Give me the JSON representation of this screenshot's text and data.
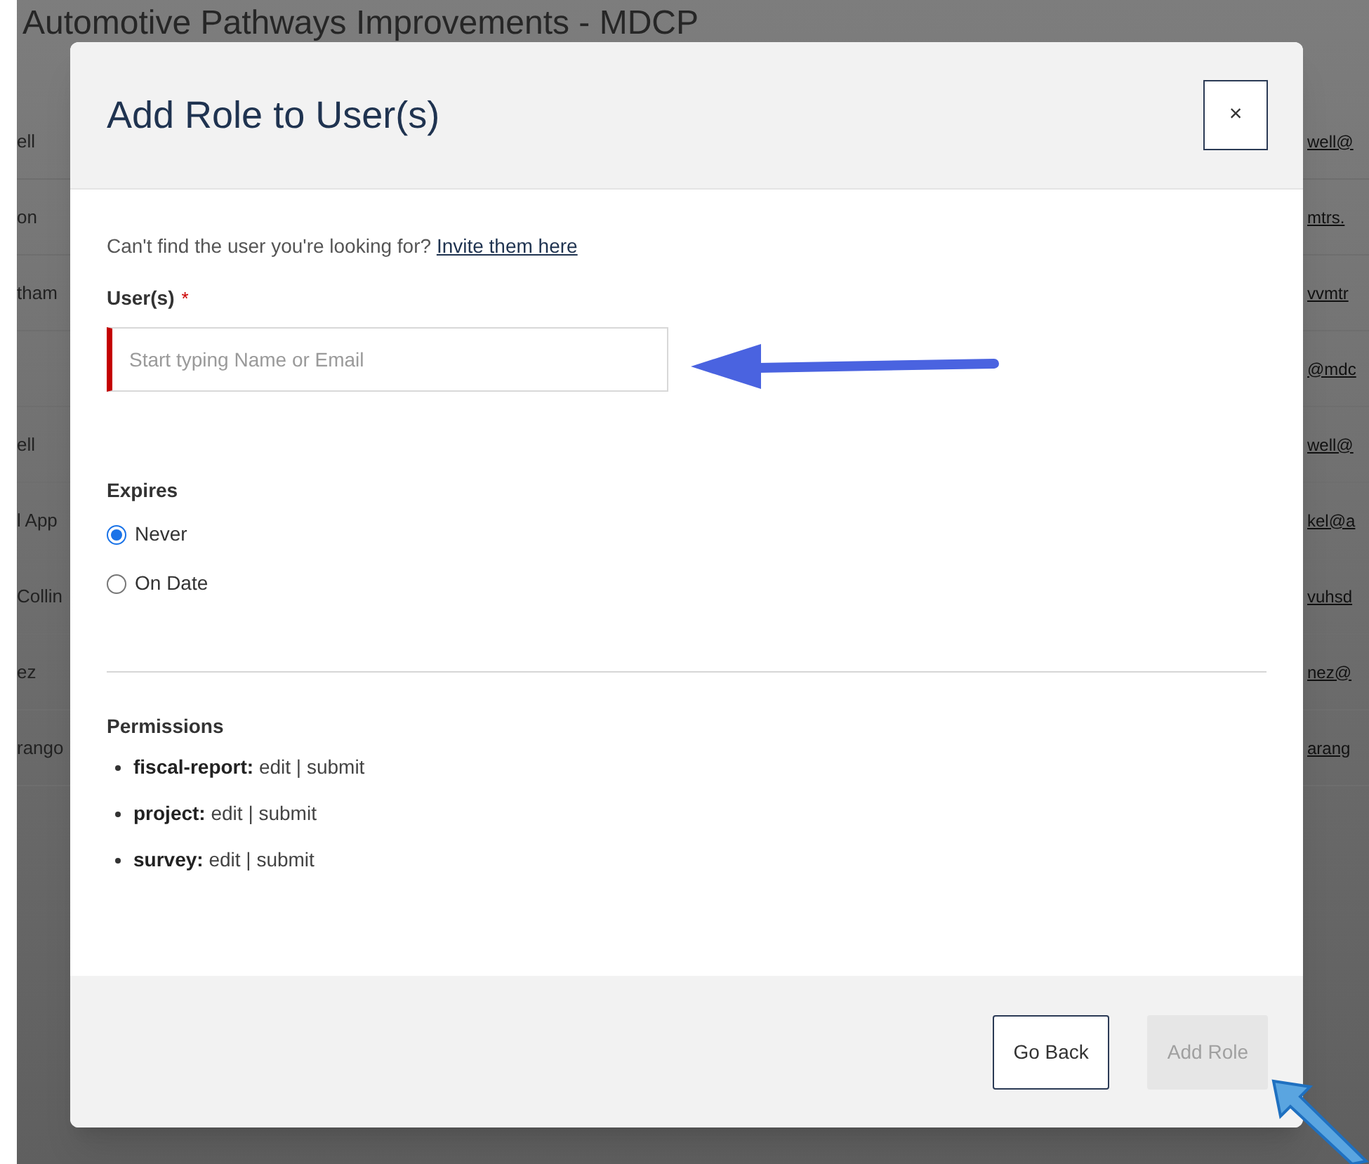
{
  "page": {
    "title": "Automotive Pathways Improvements - MDCP",
    "rows": [
      {
        "name": "ell",
        "email": "well@"
      },
      {
        "name": "on",
        "email": "mtrs."
      },
      {
        "name": "tham",
        "email": "vvmtr"
      },
      {
        "name": "",
        "email": "@mdc"
      },
      {
        "name": "ell",
        "email": "well@"
      },
      {
        "name": "l App",
        "email": "kel@a"
      },
      {
        "name": "Collin",
        "email": "vuhsd"
      },
      {
        "name": "ez",
        "email": "nez@"
      },
      {
        "name": "rango",
        "email": "arang"
      }
    ]
  },
  "modal": {
    "title": "Add Role to User(s)",
    "close": "×",
    "hint": "Can't find the user you're looking for?",
    "invite_link": "Invite them here",
    "users_field": {
      "label": "User(s)",
      "required_mark": "*",
      "placeholder": "Start typing Name or Email",
      "invalid": true
    },
    "expires": {
      "label": "Expires",
      "options": [
        {
          "label": "Never",
          "selected": true
        },
        {
          "label": "On Date",
          "selected": false
        }
      ]
    },
    "permissions": {
      "label": "Permissions",
      "items": [
        {
          "name": "fiscal-report:",
          "actions": "edit | submit"
        },
        {
          "name": "project:",
          "actions": "edit | submit"
        },
        {
          "name": "survey:",
          "actions": "edit | submit"
        }
      ]
    },
    "buttons": [
      {
        "label": "Go Back",
        "kind": "secondary",
        "disabled": false
      },
      {
        "label": "Add Role",
        "kind": "primary",
        "disabled": true
      }
    ]
  }
}
